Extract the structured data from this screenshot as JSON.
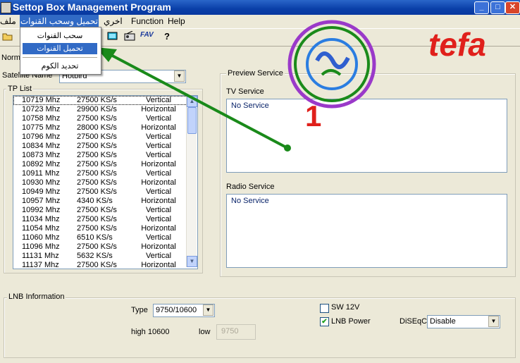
{
  "window": {
    "title": "Settop Box Management Program"
  },
  "menubar": {
    "items": [
      {
        "label": "ملف"
      },
      {
        "label": "تحميل وسحب القنوات"
      },
      {
        "label": "اخري"
      },
      {
        "label": "Function"
      },
      {
        "label": "Help"
      }
    ]
  },
  "dropdown": {
    "items": [
      {
        "label": "سحب القنوات"
      },
      {
        "label": "تحميل القنوات"
      },
      {
        "label": "تحديد الكوم"
      }
    ]
  },
  "toolbar": {
    "fav_label": "FAV",
    "help_label": "?"
  },
  "left": {
    "mode_label": "Norm",
    "satellite_label": "Satellite Name",
    "satellite_value": "Hotbird",
    "tp_list_label": "TP List",
    "tp_rows": [
      {
        "freq": "10719 Mhz",
        "sr": "27500 KS/s",
        "pol": "Vertical"
      },
      {
        "freq": "10723 Mhz",
        "sr": "29900 KS/s",
        "pol": "Horizontal"
      },
      {
        "freq": "10758 Mhz",
        "sr": "27500 KS/s",
        "pol": "Vertical"
      },
      {
        "freq": "10775 Mhz",
        "sr": "28000 KS/s",
        "pol": "Horizontal"
      },
      {
        "freq": "10796 Mhz",
        "sr": "27500 KS/s",
        "pol": "Vertical"
      },
      {
        "freq": "10834 Mhz",
        "sr": "27500 KS/s",
        "pol": "Vertical"
      },
      {
        "freq": "10873 Mhz",
        "sr": "27500 KS/s",
        "pol": "Vertical"
      },
      {
        "freq": "10892 Mhz",
        "sr": "27500 KS/s",
        "pol": "Horizontal"
      },
      {
        "freq": "10911 Mhz",
        "sr": "27500 KS/s",
        "pol": "Vertical"
      },
      {
        "freq": "10930 Mhz",
        "sr": "27500 KS/s",
        "pol": "Horizontal"
      },
      {
        "freq": "10949 Mhz",
        "sr": "27500 KS/s",
        "pol": "Vertical"
      },
      {
        "freq": "10957 Mhz",
        "sr": "4340 KS/s",
        "pol": "Horizontal"
      },
      {
        "freq": "10992 Mhz",
        "sr": "27500 KS/s",
        "pol": "Vertical"
      },
      {
        "freq": "11034 Mhz",
        "sr": "27500 KS/s",
        "pol": "Vertical"
      },
      {
        "freq": "11054 Mhz",
        "sr": "27500 KS/s",
        "pol": "Horizontal"
      },
      {
        "freq": "11060 Mhz",
        "sr": "6510 KS/s",
        "pol": "Vertical"
      },
      {
        "freq": "11096 Mhz",
        "sr": "27500 KS/s",
        "pol": "Horizontal"
      },
      {
        "freq": "11131 Mhz",
        "sr": "5632 KS/s",
        "pol": "Vertical"
      },
      {
        "freq": "11137 Mhz",
        "sr": "27500 KS/s",
        "pol": "Horizontal"
      }
    ]
  },
  "preview": {
    "label": "Preview Service",
    "tv_label": "TV Service",
    "tv_value": "No Service",
    "radio_label": "Radio Service",
    "radio_value": "No Service"
  },
  "lnb": {
    "label": "LNB Information",
    "type_label": "Type",
    "type_value": "9750/10600",
    "high_label": "high 10600",
    "low_label": "low",
    "low_value": "9750",
    "sw12v_label": "SW 12V",
    "sw12v_checked": false,
    "lnb_power_label": "LNB Power",
    "lnb_power_checked": true,
    "diseqc_label": "DiSEqC",
    "diseqc_value": "Disable"
  },
  "overlay": {
    "watermark_text": "tefa",
    "step_number": "1",
    "colors": {
      "watermark": "#e0201b",
      "arrow": "#1a8a1a",
      "step": "#e0201b"
    }
  }
}
